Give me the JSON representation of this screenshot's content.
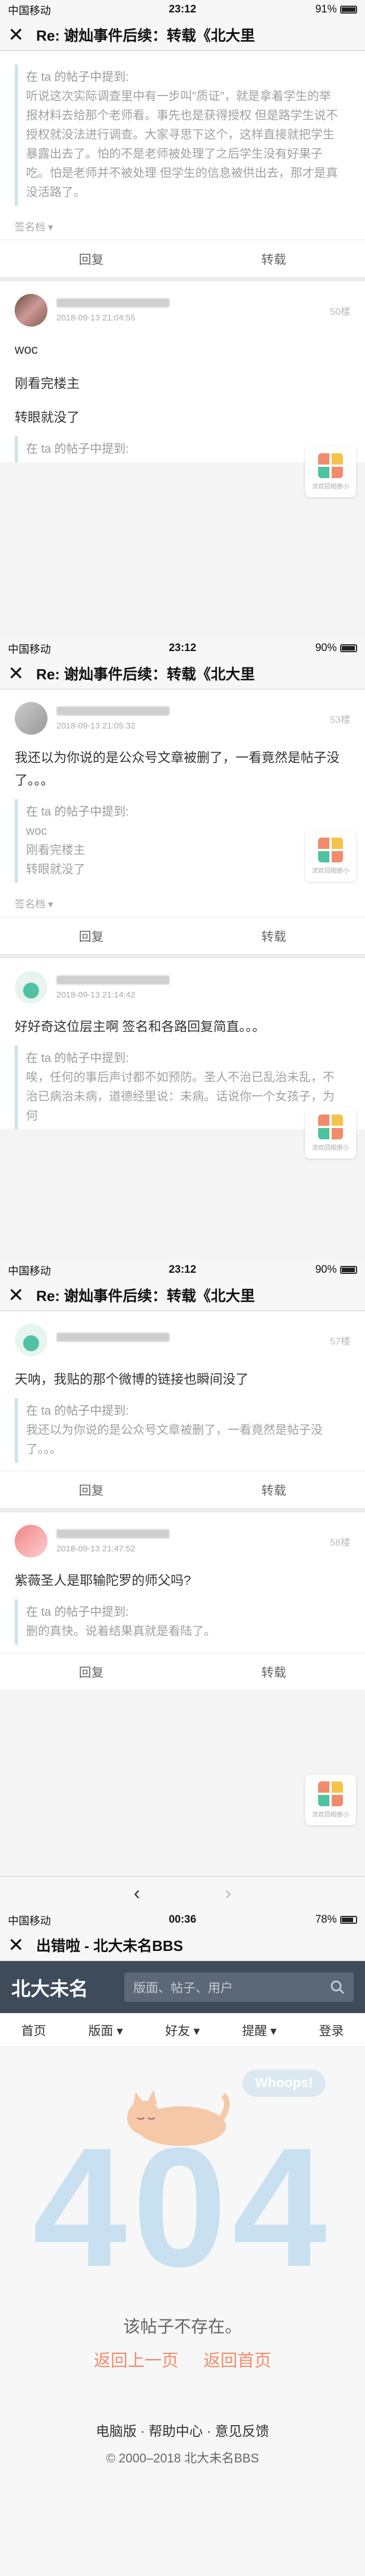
{
  "status": {
    "carrier": "中国移动",
    "battery": "91%",
    "battery_fill": 0.91,
    "time1": "23:12",
    "battery2": "90%",
    "battery2_fill": 0.9,
    "battery3": "90%",
    "battery3_fill": 0.9,
    "time4": "00:36",
    "battery4": "78%",
    "battery4_fill": 0.78
  },
  "thread_title": "Re: 谢灿事件后续：转载《北大里",
  "close_glyph": "✕",
  "tile_label": "流欢回相册小",
  "action_labels": {
    "reply": "回复",
    "forward": "转载"
  },
  "signature": "签名档 ▾",
  "posts1": {
    "quote_head": "在 ta 的帖子中提到:",
    "quote_text": "听说这次实际调查里中有一步叫\"质证\"，就是拿着学生的举报材料去给那个老师看。事先也是获得授权 但是路学生说不授权就没法进行调查。大家寻思下这个，这样直接就把学生暴露出去了。怕的不是老师被处理了之后学生没有好果子吃。怕是老师并不被处理 但学生的信息被供出去，那才是真没活路了。",
    "p50_floor": "50楼",
    "p50_time": "2018-09-13 21:04:55",
    "p50_text1": "woc",
    "p50_text2": "刚看完楼主",
    "p50_text3": "转眼就没了",
    "p50_quote_head": "在 ta 的帖子中提到:"
  },
  "posts2": {
    "p53_floor": "53楼",
    "p53_time": "2018-09-13 21:05:32",
    "p53_text": "我还以为你说的是公众号文章被删了，一看竟然是帖子没了。。。",
    "p53_quote_head": "在 ta 的帖子中提到:",
    "p53_quote_l1": "woc",
    "p53_quote_l2": "刚看完楼主",
    "p53_quote_l3": "转眼就没了",
    "p54_time": "2018-09-13 21:14:42",
    "p54_text": "好好奇这位层主啊 签名和各路回复简直。。。",
    "p54_quote_head": "在 ta 的帖子中提到:",
    "p54_quote_text": "唉，任何的事后声讨都不如预防。圣人不治已乱治未乱，不治已病治未病，道德经里说：未病。话说你一个女孩子，为何"
  },
  "posts3": {
    "p57_floor": "57楼",
    "p57_text": "天呐，我贴的那个微博的链接也瞬间没了",
    "p57_quote_head": "在 ta 的帖子中提到:",
    "p57_quote_text": "我还以为你说的是公众号文章被删了，一看竟然是帖子没了。。。",
    "p58_floor": "58楼",
    "p58_time": "2018-09-13 21:47:52",
    "p58_text": "紫薇圣人是耶输陀罗的师父吗?",
    "p58_quote_head": "在 ta 的帖子中提到:",
    "p58_quote_text": "删的真快。说着结果真就是看陆了。",
    "nav_prev": "‹",
    "nav_next": "›"
  },
  "page404": {
    "title": "出错啦 - 北大未名BBS",
    "logo": "北大未名",
    "search_placeholder": "版面、帖子、用户",
    "menu": [
      "首页",
      "版面 ▾",
      "好友 ▾",
      "提醒 ▾",
      "登录"
    ],
    "whoops": "Whoops!",
    "big": "404",
    "not_found": "该帖子不存在。",
    "back": "返回上一页",
    "home": "返回首页",
    "footer": "电脑版 · 帮助中心 · 意见反馈",
    "copyright": "© 2000–2018 北大未名BBS"
  }
}
